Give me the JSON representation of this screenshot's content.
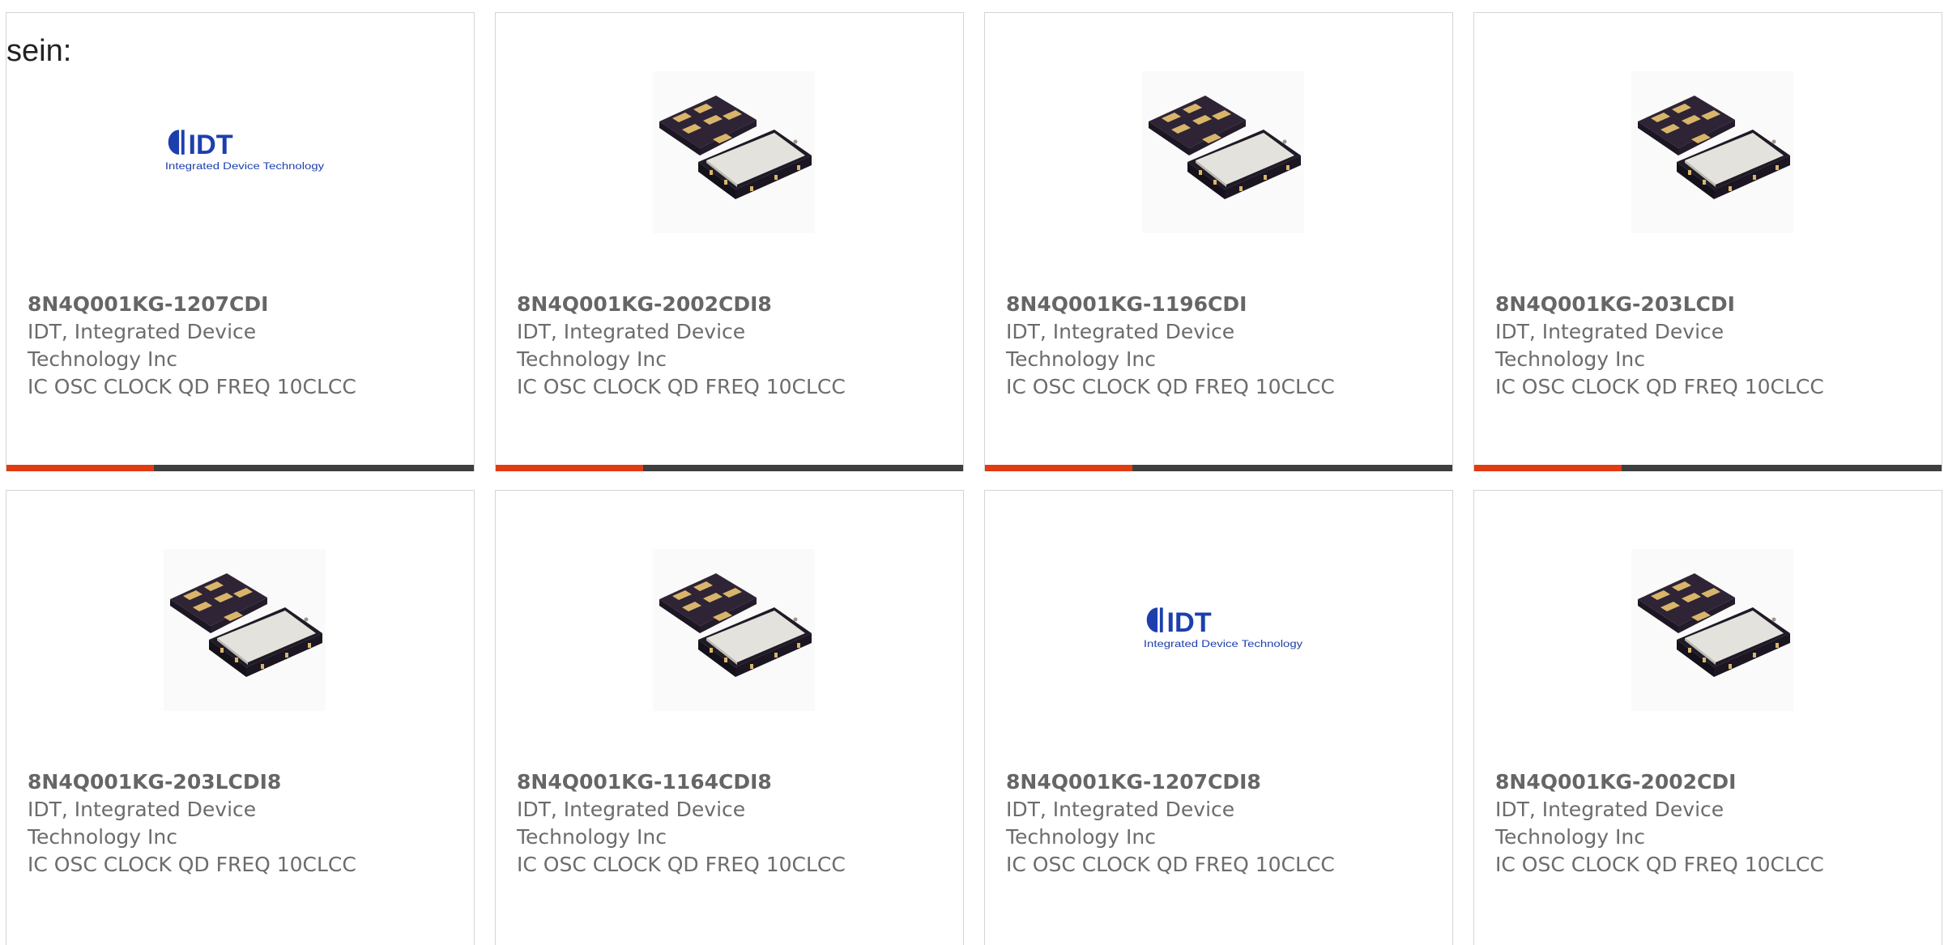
{
  "intro_text": "sein:",
  "colors": {
    "accent": "#e03c12",
    "bar_dark": "#3f3f3f",
    "card_border": "#d4d4d4",
    "text": "#6c6c6c",
    "idt_blue": "#1d3fae"
  },
  "products": [
    {
      "part_number": "8N4Q001KG-1207CDI",
      "manufacturer": "IDT, Integrated Device Technology Inc",
      "description": "IC OSC CLOCK QD FREQ 10CLCC",
      "image": "idt-logo"
    },
    {
      "part_number": "8N4Q001KG-2002CDI8",
      "manufacturer": "IDT, Integrated Device Technology Inc",
      "description": "IC OSC CLOCK QD FREQ 10CLCC",
      "image": "chip-package"
    },
    {
      "part_number": "8N4Q001KG-1196CDI",
      "manufacturer": "IDT, Integrated Device Technology Inc",
      "description": "IC OSC CLOCK QD FREQ 10CLCC",
      "image": "chip-package"
    },
    {
      "part_number": "8N4Q001KG-203LCDI",
      "manufacturer": "IDT, Integrated Device Technology Inc",
      "description": "IC OSC CLOCK QD FREQ 10CLCC",
      "image": "chip-package"
    },
    {
      "part_number": "8N4Q001KG-203LCDI8",
      "manufacturer": "IDT, Integrated Device Technology Inc",
      "description": "IC OSC CLOCK QD FREQ 10CLCC",
      "image": "chip-package"
    },
    {
      "part_number": "8N4Q001KG-1164CDI8",
      "manufacturer": "IDT, Integrated Device Technology Inc",
      "description": "IC OSC CLOCK QD FREQ 10CLCC",
      "image": "chip-package"
    },
    {
      "part_number": "8N4Q001KG-1207CDI8",
      "manufacturer": "IDT, Integrated Device Technology Inc",
      "description": "IC OSC CLOCK QD FREQ 10CLCC",
      "image": "idt-logo"
    },
    {
      "part_number": "8N4Q001KG-2002CDI",
      "manufacturer": "IDT, Integrated Device Technology Inc",
      "description": "IC OSC CLOCK QD FREQ 10CLCC",
      "image": "chip-package"
    }
  ],
  "logo": {
    "wordmark": "IDT",
    "tagline": "Integrated Device Technology"
  }
}
